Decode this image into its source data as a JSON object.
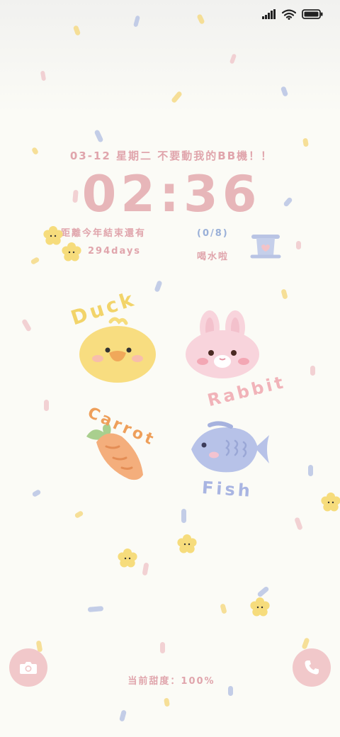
{
  "status_bar": {
    "signal_icon": "signal-bars-icon",
    "wifi_icon": "wifi-icon",
    "battery_icon": "battery-full-icon"
  },
  "header": {
    "date_line": "03-12 星期二 不要動我的BB機！！",
    "time": "02:36"
  },
  "widgets": {
    "countdown_label": "距離今年結束還有",
    "countdown_days": "294days",
    "water_progress": "(0/8)",
    "water_label": "喝水啦"
  },
  "illustrations": {
    "duck_word": "Duck",
    "rabbit_word": "Rabbit",
    "carrot_word": "Carrot",
    "fish_word": "Fish"
  },
  "footer": {
    "sweetness": "当前甜度：100%",
    "camera_icon": "camera-icon",
    "phone_icon": "phone-icon"
  },
  "colors": {
    "pink": "#e0a5ac",
    "button_pink": "#f1c8ca",
    "blue": "#9ab0d8",
    "yellow": "#f6dc7c",
    "orange": "#f2a96f"
  }
}
